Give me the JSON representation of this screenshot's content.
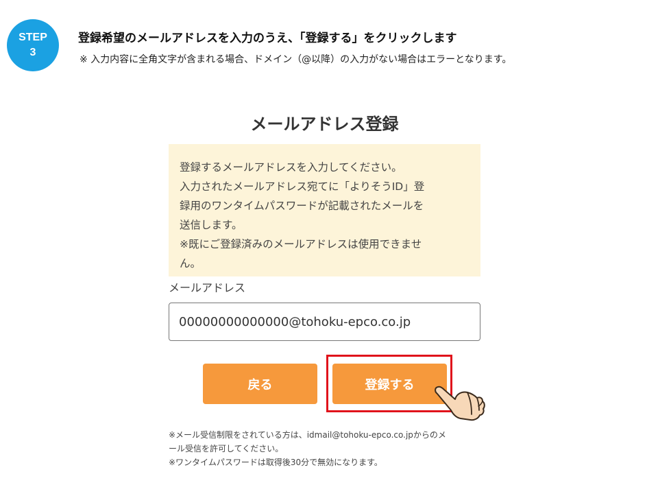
{
  "step": {
    "label": "STEP",
    "number": "3"
  },
  "instruction": {
    "title": "登録希望のメールアドレスを入力のうえ、「登録する」をクリックします",
    "note": "※ 入力内容に全角文字が含まれる場合、ドメイン（@以降）の入力がない場合はエラーとなります。"
  },
  "form": {
    "title": "メールアドレス登録",
    "info_lines": [
      "登録するメールアドレスを入力してください。",
      "入力されたメールアドレス宛てに「よりそうID」登",
      "録用のワンタイムパスワードが記載されたメールを",
      "送信します。",
      "※既にご登録済みのメールアドレスは使用できませ",
      "ん。"
    ],
    "email_label": "メールアドレス",
    "email_value": "00000000000000@tohoku-epco.co.jp",
    "back_label": "戻る",
    "register_label": "登録する",
    "footnote_lines": [
      "※メール受信制限をされている方は、idmail@tohoku-epco.co.jpからのメ",
      "ール受信を許可してください。",
      "※ワンタイムパスワードは取得後30分で無効になります。"
    ]
  },
  "colors": {
    "step_badge": "#1ba1e2",
    "info_background": "#fdf4d9",
    "button": "#f6993c",
    "highlight": "#e0131b"
  },
  "icons": {
    "pointer": "pointing-hand-icon"
  }
}
